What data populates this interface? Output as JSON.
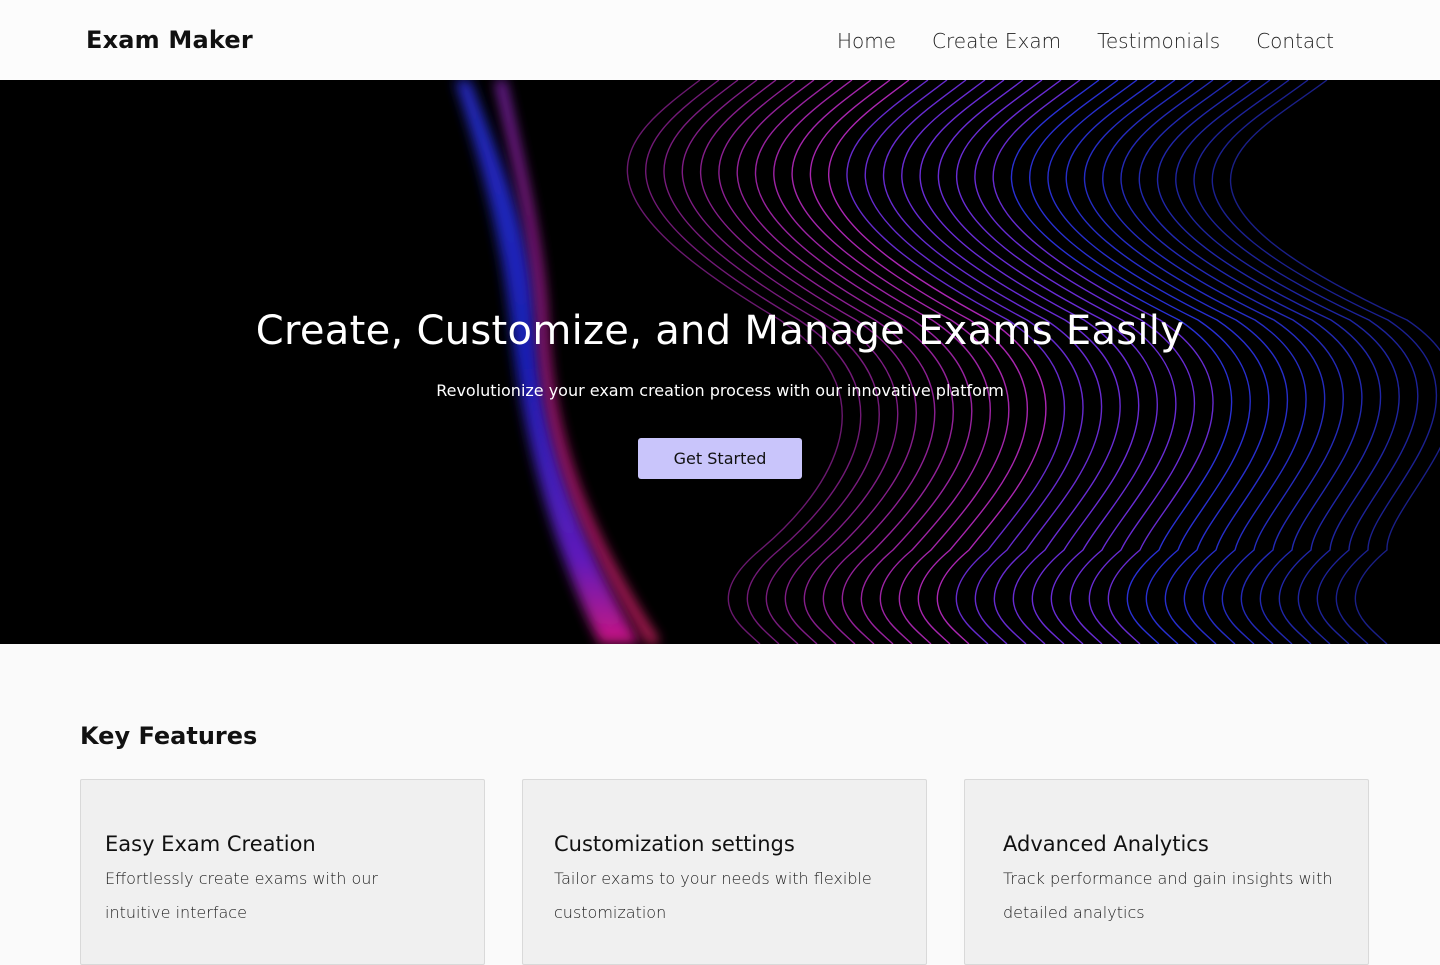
{
  "header": {
    "brand": "Exam Maker",
    "nav": [
      "Home",
      "Create Exam",
      "Testimonials",
      "Contact"
    ]
  },
  "hero": {
    "title": "Create, Customize, and Manage Exams Easily",
    "subtitle": "Revolutionize your exam creation process with our innovative platform",
    "cta_label": "Get Started"
  },
  "features": {
    "title": "Key Features",
    "cards": [
      {
        "title": "Easy Exam Creation",
        "text": "Effortlessly create exams with our intuitive interface"
      },
      {
        "title": "Customization settings",
        "text": "Tailor exams to your needs with flexible customization"
      },
      {
        "title": "Advanced Analytics",
        "text": "Track performance and gain insights with detailed analytics"
      }
    ]
  },
  "colors": {
    "cta_bg": "#c9c5fb",
    "hero_bg": "#000000",
    "wave_blue": "#2a2fd6",
    "wave_magenta": "#d41b9c"
  }
}
